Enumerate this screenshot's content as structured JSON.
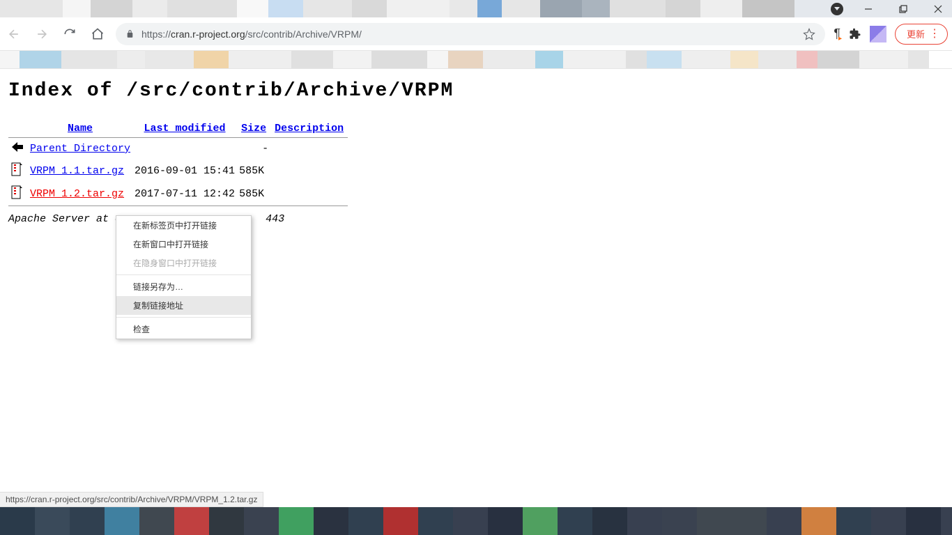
{
  "browser": {
    "url_prefix": "https://",
    "url_host": "cran.r-project.org",
    "url_path": "/src/contrib/Archive/VRPM/",
    "update_label": "更新"
  },
  "page": {
    "title": "Index of /src/contrib/Archive/VRPM",
    "headers": {
      "name": "Name",
      "last_modified": "Last modified",
      "size": "Size",
      "description": "Description"
    },
    "parent_link": "Parent Directory",
    "parent_size": "-",
    "files": [
      {
        "name": "VRPM_1.1.tar.gz",
        "modified": "2016-09-01 15:41",
        "size": "585K",
        "active": false
      },
      {
        "name": "VRPM_1.2.tar.gz",
        "modified": "2017-07-11 12:42",
        "size": "585K",
        "active": true
      }
    ],
    "footer_prefix": "Apache Server at c",
    "footer_suffix": " 443"
  },
  "context_menu": {
    "items": [
      {
        "label": "在新标签页中打开链接",
        "disabled": false
      },
      {
        "label": "在新窗口中打开链接",
        "disabled": false
      },
      {
        "label": "在隐身窗口中打开链接",
        "disabled": true
      }
    ],
    "save_as": "链接另存为…",
    "copy_link": "复制链接地址",
    "inspect": "检查"
  },
  "status_bar": "https://cran.r-project.org/src/contrib/Archive/VRPM/VRPM_1.2.tar.gz"
}
